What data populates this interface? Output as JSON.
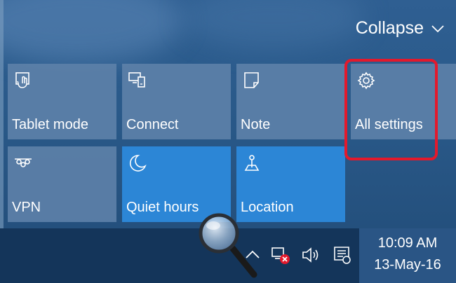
{
  "header": {
    "collapse_label": "Collapse"
  },
  "tiles": [
    {
      "label": "Tablet mode",
      "icon": "tablet-mode-icon",
      "active": false
    },
    {
      "label": "Connect",
      "icon": "connect-icon",
      "active": false
    },
    {
      "label": "Note",
      "icon": "note-icon",
      "active": false
    },
    {
      "label": "All settings",
      "icon": "gear-icon",
      "active": false
    },
    {
      "label": "VPN",
      "icon": "vpn-icon",
      "active": false
    },
    {
      "label": "Quiet hours",
      "icon": "moon-icon",
      "active": true
    },
    {
      "label": "Location",
      "icon": "location-icon",
      "active": true
    }
  ],
  "taskbar": {
    "icons": [
      "chevron-up-icon",
      "network-disconnected-icon",
      "volume-icon",
      "action-center-icon"
    ],
    "time": "10:09 AM",
    "date": "13-May-16"
  },
  "colors": {
    "tile_inactive": "#5c80a8",
    "tile_active": "#2c86d6",
    "highlight": "#e3192c",
    "taskbar": "#14355a"
  }
}
